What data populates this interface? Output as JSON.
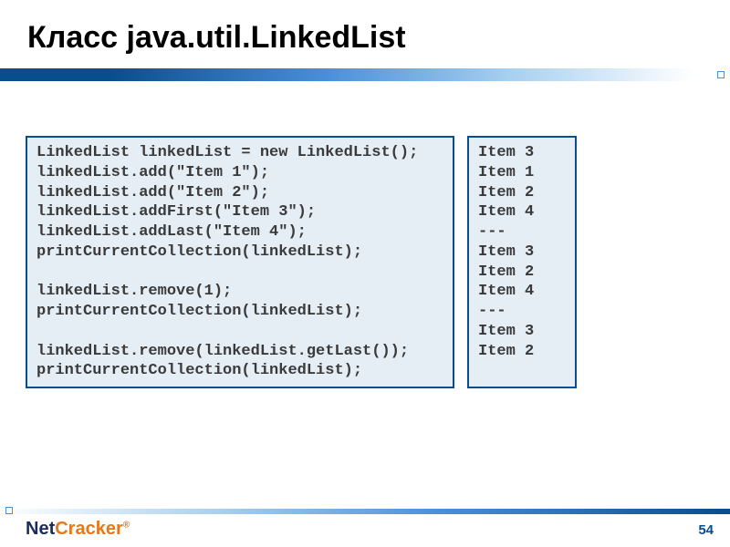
{
  "title": "Класс java.util.LinkedList",
  "code": "LinkedList linkedList = new LinkedList();\nlinkedList.add(\"Item 1\");\nlinkedList.add(\"Item 2\");\nlinkedList.addFirst(\"Item 3\");\nlinkedList.addLast(\"Item 4\");\nprintCurrentCollection(linkedList);\n\nlinkedList.remove(1);\nprintCurrentCollection(linkedList);\n\nlinkedList.remove(linkedList.getLast());\nprintCurrentCollection(linkedList);",
  "output": "Item 3\nItem 1\nItem 2\nItem 4\n---\nItem 3\nItem 2\nItem 4\n---\nItem 3\nItem 2",
  "logo": {
    "part1": "Net",
    "part2": "Cracker",
    "reg": "®"
  },
  "pageNumber": "54"
}
